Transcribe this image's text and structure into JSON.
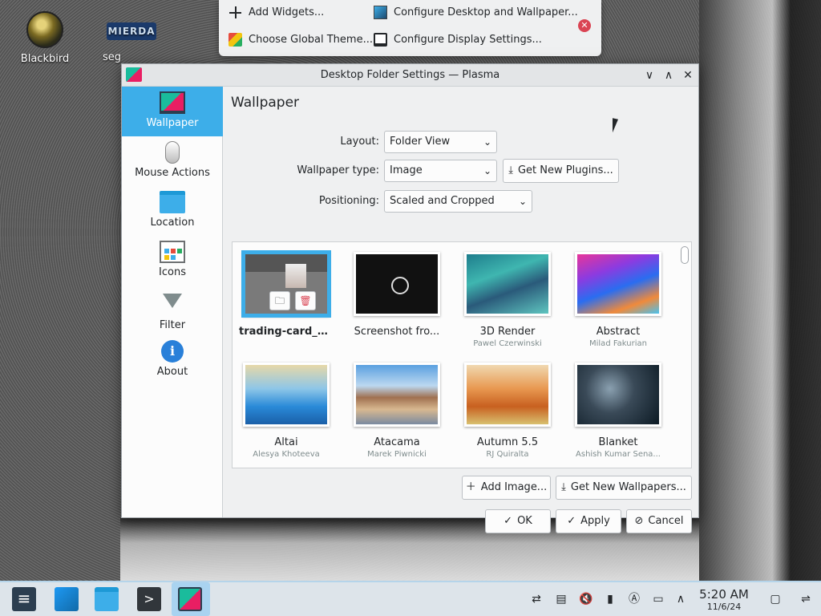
{
  "desktop": {
    "icons": [
      {
        "label": "Blackbird",
        "icon": "blackbird-app-icon"
      },
      {
        "label": "seg",
        "badge_text": "MIERDA",
        "icon": "mierda-app-icon"
      }
    ]
  },
  "context_menu": {
    "items": [
      {
        "label": "Add Widgets...",
        "icon": "plus-icon"
      },
      {
        "label": "Configure Desktop and Wallpaper...",
        "icon": "wallpaper-icon"
      },
      {
        "label": "Choose Global Theme...",
        "icon": "theme-icon"
      },
      {
        "label": "Configure Display Settings...",
        "icon": "display-icon"
      }
    ],
    "close_glyph": "✕"
  },
  "dialog": {
    "title": "Desktop Folder Settings — Plasma",
    "titlebar_buttons": {
      "minimize": "∨",
      "maximize": "∧",
      "close": "✕"
    },
    "sidebar": [
      {
        "label": "Wallpaper",
        "icon": "wallpaper-icon",
        "active": true
      },
      {
        "label": "Mouse Actions",
        "icon": "mouse-icon",
        "active": false
      },
      {
        "label": "Location",
        "icon": "folder-icon",
        "active": false
      },
      {
        "label": "Icons",
        "icon": "icons-icon",
        "active": false
      },
      {
        "label": "Filter",
        "icon": "filter-icon",
        "active": false
      },
      {
        "label": "About",
        "icon": "info-icon",
        "active": false
      }
    ],
    "about_glyph": "i",
    "page_title": "Wallpaper",
    "form": {
      "layout_label": "Layout:",
      "layout_value": "Folder View",
      "wallpaper_type_label": "Wallpaper type:",
      "wallpaper_type_value": "Image",
      "get_new_plugins": "Get New Plugins...",
      "positioning_label": "Positioning:",
      "positioning_value": "Scaled and Cropped"
    },
    "wallpapers": [
      {
        "name": "trading-card_1...",
        "author": "",
        "selected": true
      },
      {
        "name": "Screenshot fro...",
        "author": "",
        "selected": false
      },
      {
        "name": "3D Render",
        "author": "Pawel Czerwinski",
        "selected": false
      },
      {
        "name": "Abstract",
        "author": "Milad Fakurian",
        "selected": false
      },
      {
        "name": "Altai",
        "author": "Alesya Khoteeva",
        "selected": false
      },
      {
        "name": "Atacama",
        "author": "Marek Piwnicki",
        "selected": false
      },
      {
        "name": "Autumn 5.5",
        "author": "RJ Quiralta",
        "selected": false
      },
      {
        "name": "Blanket",
        "author": "Ashish Kumar Sena...",
        "selected": false
      }
    ],
    "buttons": {
      "add_image": "Add Image...",
      "get_new_wallpapers": "Get New Wallpapers...",
      "ok": "OK",
      "apply": "Apply",
      "cancel": "Cancel"
    }
  },
  "taskbar": {
    "apps": [
      "settings-app-icon",
      "discover-app-icon",
      "files-app-icon",
      "konsole-app-icon",
      "wallpaper-settings-app-icon"
    ],
    "clock_time": "5:20 AM",
    "clock_date": "11/6/24"
  },
  "colors": {
    "accent": "#3daee9",
    "window_bg": "#eff0f1",
    "close_red": "#da4453"
  }
}
